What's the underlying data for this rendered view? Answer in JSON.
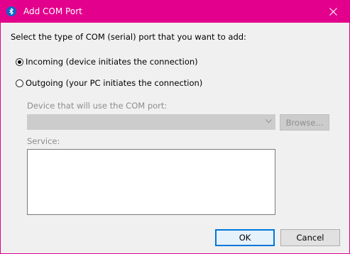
{
  "window": {
    "title": "Add COM Port",
    "accent_color": "#e3008c",
    "title_icon": "bluetooth-icon",
    "close_icon": "close-icon"
  },
  "dialog": {
    "instruction": "Select the type of COM (serial) port that you want to add:",
    "options": [
      {
        "label": "Incoming (device initiates the connection)",
        "checked": true
      },
      {
        "label": "Outgoing (your PC initiates the connection)",
        "checked": false
      }
    ],
    "device_label": "Device that will use the COM port:",
    "device_value": "",
    "browse_label": "Browse...",
    "service_label": "Service:",
    "ok_label": "OK",
    "cancel_label": "Cancel"
  }
}
